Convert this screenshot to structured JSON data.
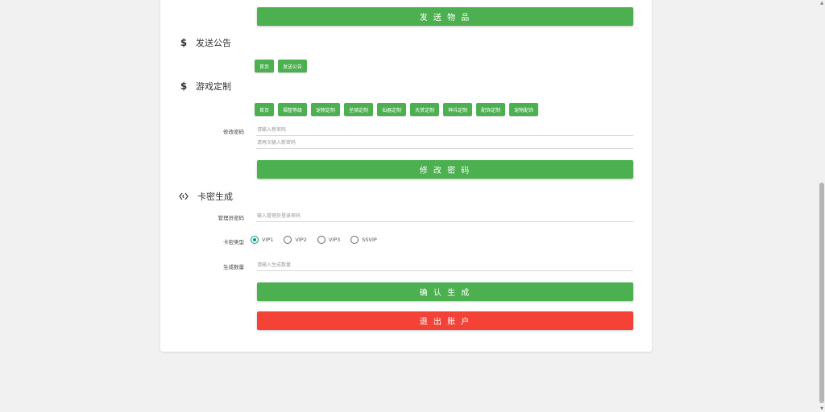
{
  "send_item_button": "发 送 物 品",
  "announce": {
    "title": "发送公告",
    "icon": "dollar-icon",
    "buttons": [
      "首页",
      "发送公告"
    ]
  },
  "game": {
    "title": "游戏定制",
    "icon": "dollar-icon",
    "buttons": [
      "首页",
      "福整等级",
      "宠物定制",
      "坐骑定制",
      "仙器定制",
      "天赏定制",
      "神兵定制",
      "配饰定制",
      "宠物配饰"
    ]
  },
  "password": {
    "label": "修改密码",
    "new_placeholder": "请输入新密码",
    "confirm_placeholder": "请再次输入新密码",
    "button": "修 改 密 码"
  },
  "cardkey": {
    "title": "卡密生成",
    "icon": "code-icon",
    "admin_label": "管理员密码",
    "admin_placeholder": "输入管理员登录密码",
    "type_label": "卡密类型",
    "types": [
      "VIP1",
      "VIP2",
      "VIP3",
      "SSVIP"
    ],
    "selected_type": "VIP1",
    "count_label": "生成数量",
    "count_placeholder": "请输入生成数量",
    "confirm_button": "确 认 生 成",
    "logout_button": "退 出 账 户"
  },
  "colors": {
    "primary": "#4caf50",
    "danger": "#f44336",
    "radio_checked": "#009688"
  }
}
